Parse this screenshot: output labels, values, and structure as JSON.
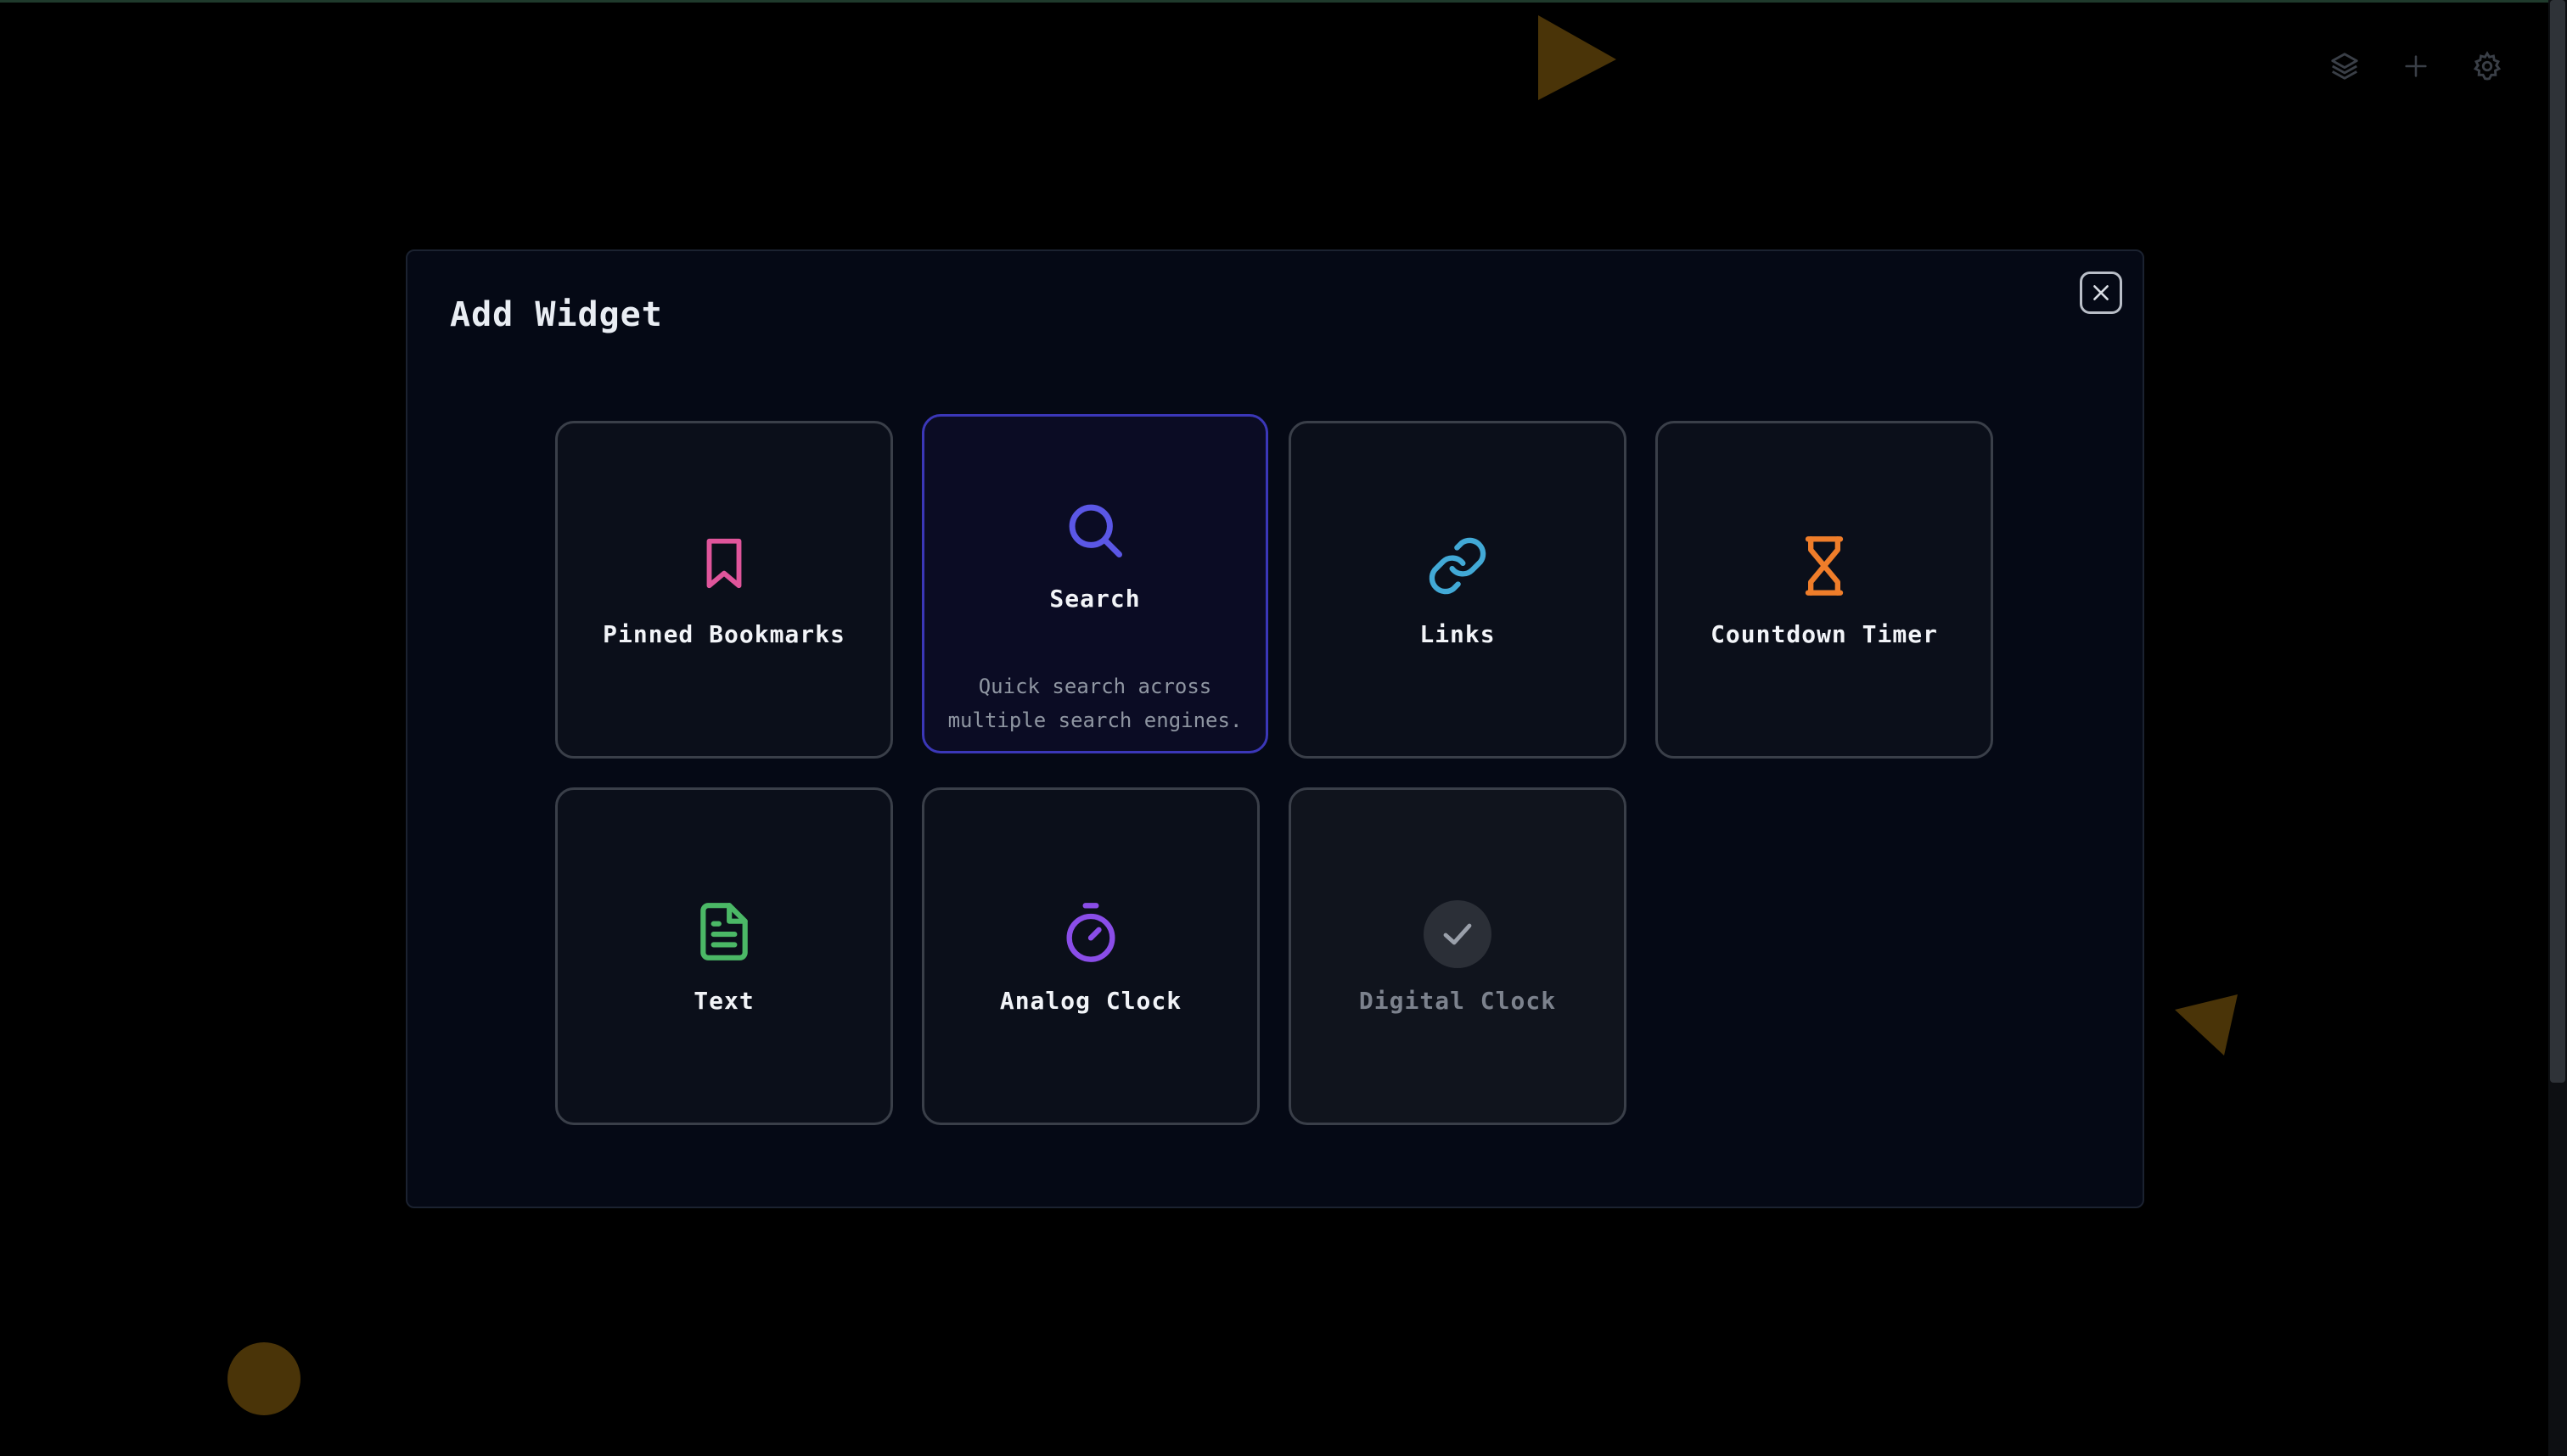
{
  "top_toolbar": {
    "icons": [
      "layers-icon",
      "plus-icon",
      "gear-icon"
    ]
  },
  "modal": {
    "title": "Add Widget",
    "close_icon": "close-icon"
  },
  "widgets": [
    {
      "label": "Pinned Bookmarks",
      "icon": "bookmark-icon",
      "color": "#e0559b",
      "state": "normal"
    },
    {
      "label": "Search",
      "icon": "search-icon",
      "color": "#5b57e6",
      "state": "hovered",
      "description": "Quick search across multiple search engines."
    },
    {
      "label": "Links",
      "icon": "link-icon",
      "color": "#42a9d6",
      "state": "normal"
    },
    {
      "label": "Countdown Timer",
      "icon": "hourglass-icon",
      "color": "#ef7d2a",
      "state": "normal"
    },
    {
      "label": "Text",
      "icon": "document-icon",
      "color": "#4bb866",
      "state": "normal"
    },
    {
      "label": "Analog Clock",
      "icon": "stopwatch-icon",
      "color": "#8a4de8",
      "state": "normal"
    },
    {
      "label": "Digital Clock",
      "icon": "check-icon",
      "color": "#7c828d",
      "state": "added"
    }
  ],
  "colors": {
    "background": "#000000",
    "modal_bg": "#050915",
    "card_border": "#3a3f49",
    "active_border": "#3b37b8"
  }
}
